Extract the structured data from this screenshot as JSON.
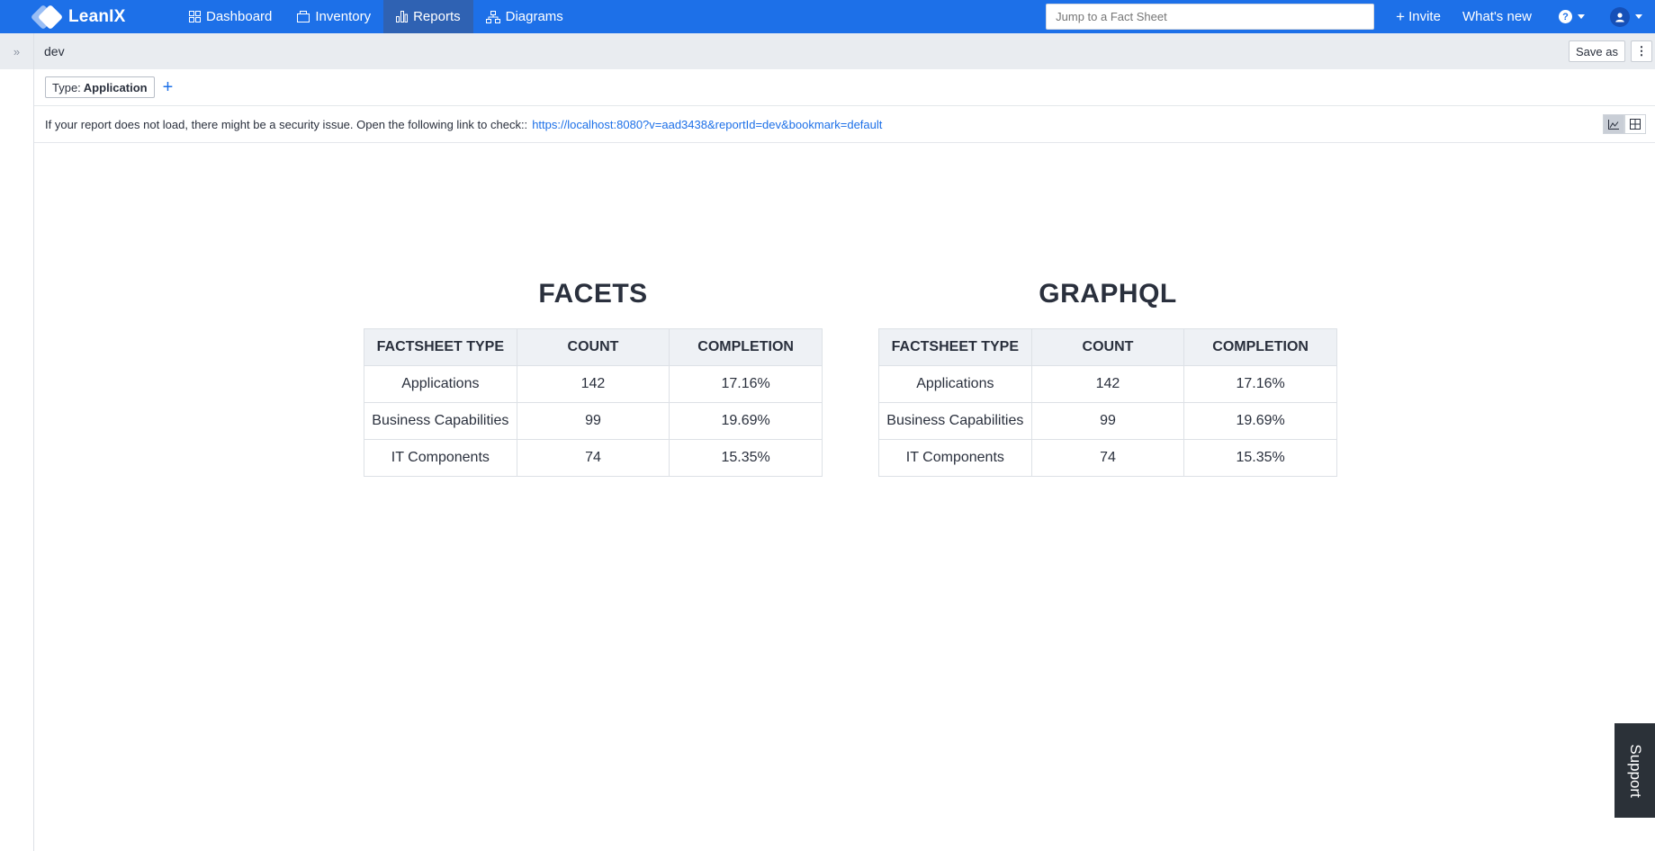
{
  "nav": {
    "brand": "LeanIX",
    "items": [
      {
        "label": "Dashboard",
        "icon": "grid-icon",
        "active": false
      },
      {
        "label": "Inventory",
        "icon": "inventory-icon",
        "active": false
      },
      {
        "label": "Reports",
        "icon": "reports-icon",
        "active": true
      },
      {
        "label": "Diagrams",
        "icon": "diagram-icon",
        "active": false
      }
    ],
    "search_placeholder": "Jump to a Fact Sheet",
    "invite_label": "Invite",
    "whats_new_label": "What's new"
  },
  "report": {
    "name": "dev",
    "save_as_label": "Save as",
    "more_label": "⋮"
  },
  "filter": {
    "prefix": "Type:",
    "value": "Application"
  },
  "notice": {
    "text": "If your report does not load, there might be a security issue. Open the following link to check::",
    "link": "https://localhost:8080?v=aad3438&reportId=dev&bookmark=default"
  },
  "tables": [
    {
      "title": "FACETS",
      "headers": [
        "FACTSHEET TYPE",
        "COUNT",
        "COMPLETION"
      ],
      "rows": [
        [
          "Applications",
          "142",
          "17.16%"
        ],
        [
          "Business Capabilities",
          "99",
          "19.69%"
        ],
        [
          "IT Components",
          "74",
          "15.35%"
        ]
      ]
    },
    {
      "title": "GRAPHQL",
      "headers": [
        "FACTSHEET TYPE",
        "COUNT",
        "COMPLETION"
      ],
      "rows": [
        [
          "Applications",
          "142",
          "17.16%"
        ],
        [
          "Business Capabilities",
          "99",
          "19.69%"
        ],
        [
          "IT Components",
          "74",
          "15.35%"
        ]
      ]
    }
  ],
  "support_label": "Support",
  "colors": {
    "nav_bg": "#1d70e8",
    "nav_active": "#2f62b3",
    "link": "#1d70e8"
  }
}
